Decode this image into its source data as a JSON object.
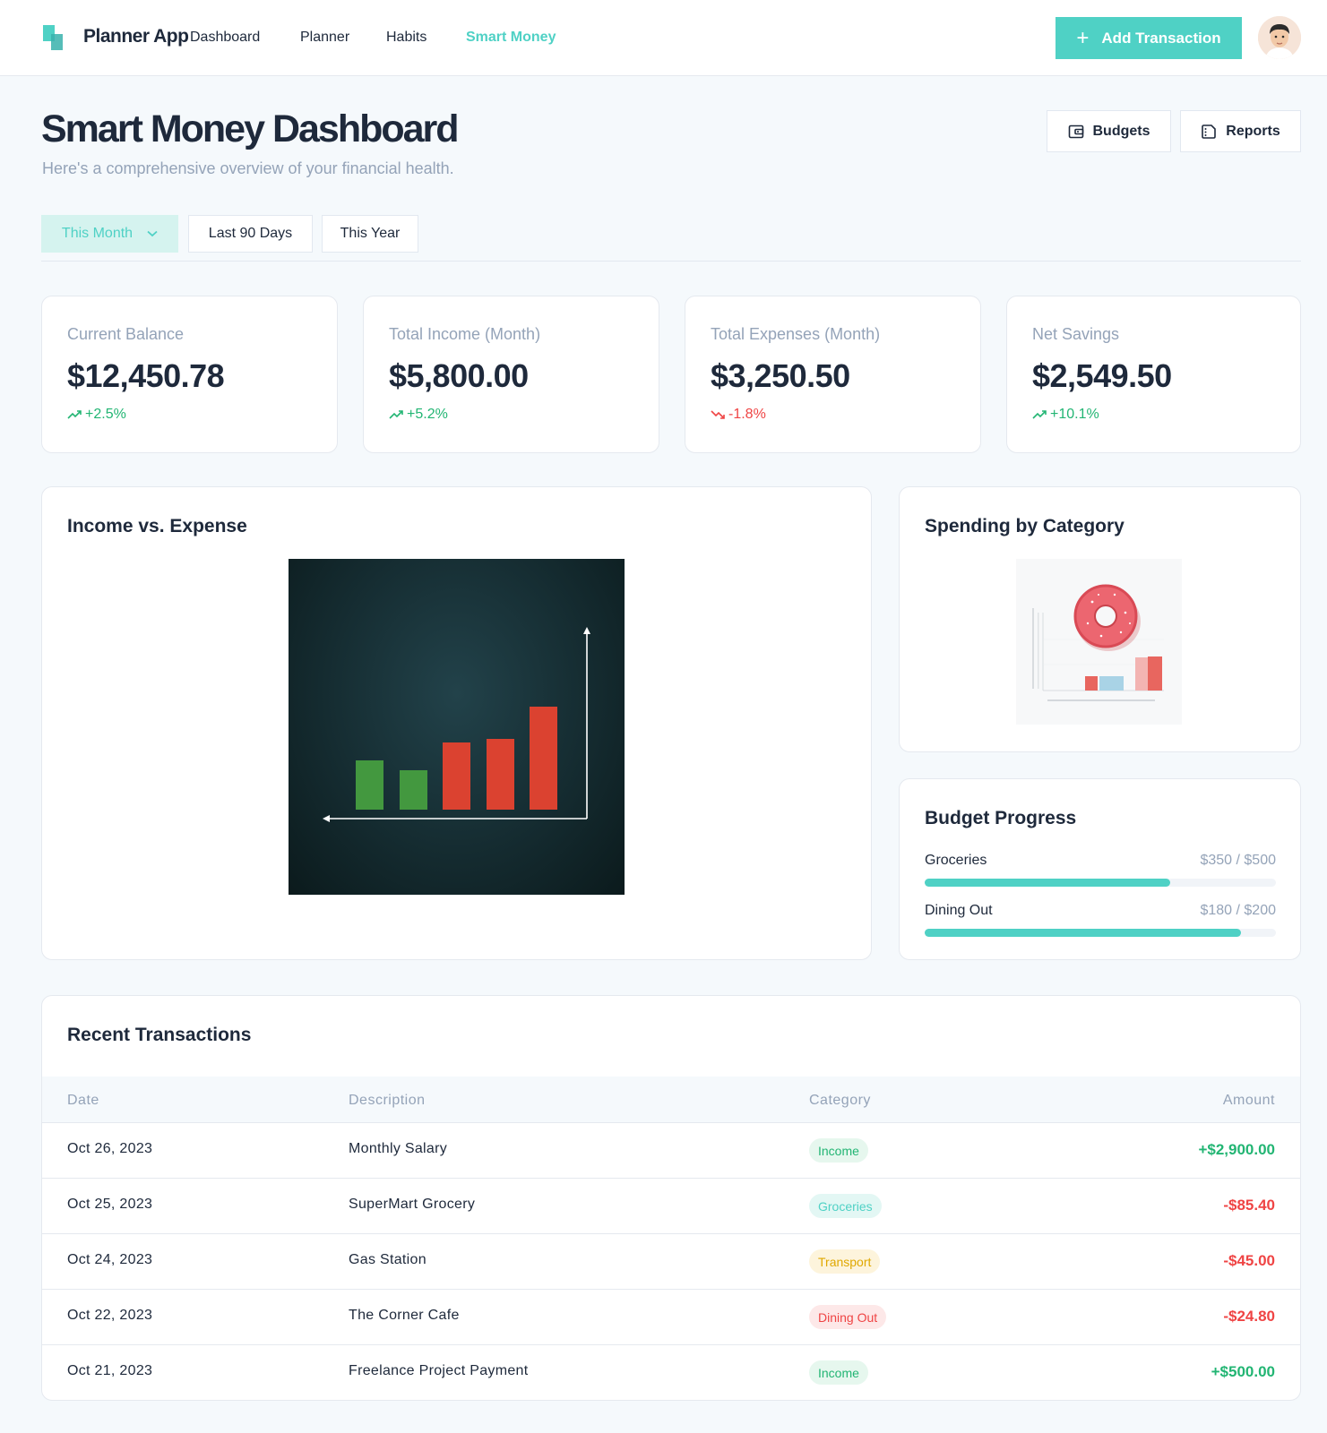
{
  "app": {
    "brand": "Planner App",
    "nav": [
      {
        "label": "Dashboard",
        "active": false
      },
      {
        "label": "Planner",
        "active": false
      },
      {
        "label": "Habits",
        "active": false
      },
      {
        "label": "Smart Money",
        "active": true
      }
    ],
    "add_transaction_label": "Add Transaction",
    "accent_color": "#4fd1c5"
  },
  "header": {
    "title": "Smart Money Dashboard",
    "subtitle": "Here's a comprehensive overview of your financial health.",
    "budgets_label": "Budgets",
    "reports_label": "Reports"
  },
  "filters": [
    {
      "label": "This Month",
      "active": true
    },
    {
      "label": "Last 90 Days",
      "active": false
    },
    {
      "label": "This Year",
      "active": false
    }
  ],
  "stats": [
    {
      "label": "Current Balance",
      "value": "$12,450.78",
      "change": "+2.5%",
      "trend": "up"
    },
    {
      "label": "Total Income (Month)",
      "value": "$5,800.00",
      "change": "+5.2%",
      "trend": "up"
    },
    {
      "label": "Total Expenses (Month)",
      "value": "$3,250.50",
      "change": "-1.8%",
      "trend": "down"
    },
    {
      "label": "Net Savings",
      "value": "$2,549.50",
      "change": "+10.1%",
      "trend": "up"
    }
  ],
  "income_expense": {
    "title": "Income vs. Expense"
  },
  "spending": {
    "title": "Spending by Category"
  },
  "budget": {
    "title": "Budget Progress",
    "items": [
      {
        "name": "Groceries",
        "amount": "$350 / $500",
        "progress": 0.7
      },
      {
        "name": "Dining Out",
        "amount": "$180 / $200",
        "progress": 0.9
      }
    ]
  },
  "transactions": {
    "title": "Recent Transactions",
    "columns": [
      "Date",
      "Description",
      "Category",
      "Amount"
    ],
    "rows": [
      {
        "date": "Oct 26, 2023",
        "description": "Monthly Salary",
        "category": "Income",
        "amount": "+$2,900.00",
        "type": "income"
      },
      {
        "date": "Oct 25, 2023",
        "description": "SuperMart Grocery",
        "category": "Groceries",
        "amount": "-$85.40",
        "type": "expense"
      },
      {
        "date": "Oct 24, 2023",
        "description": "Gas Station",
        "category": "Transport",
        "amount": "-$45.00",
        "type": "expense"
      },
      {
        "date": "Oct 22, 2023",
        "description": "The Corner Cafe",
        "category": "Dining Out",
        "amount": "-$24.80",
        "type": "expense"
      },
      {
        "date": "Oct 21, 2023",
        "description": "Freelance Project Payment",
        "category": "Income",
        "amount": "+$500.00",
        "type": "income"
      }
    ]
  },
  "category_colors": {
    "Income": {
      "bg": "#e6f7ee",
      "fg": "#22b573"
    },
    "Groceries": {
      "bg": "#e3f7f4",
      "fg": "#4fd1c5"
    },
    "Transport": {
      "bg": "#fdf4dc",
      "fg": "#e0a800"
    },
    "Dining Out": {
      "bg": "#fde8e8",
      "fg": "#ef4444"
    }
  }
}
